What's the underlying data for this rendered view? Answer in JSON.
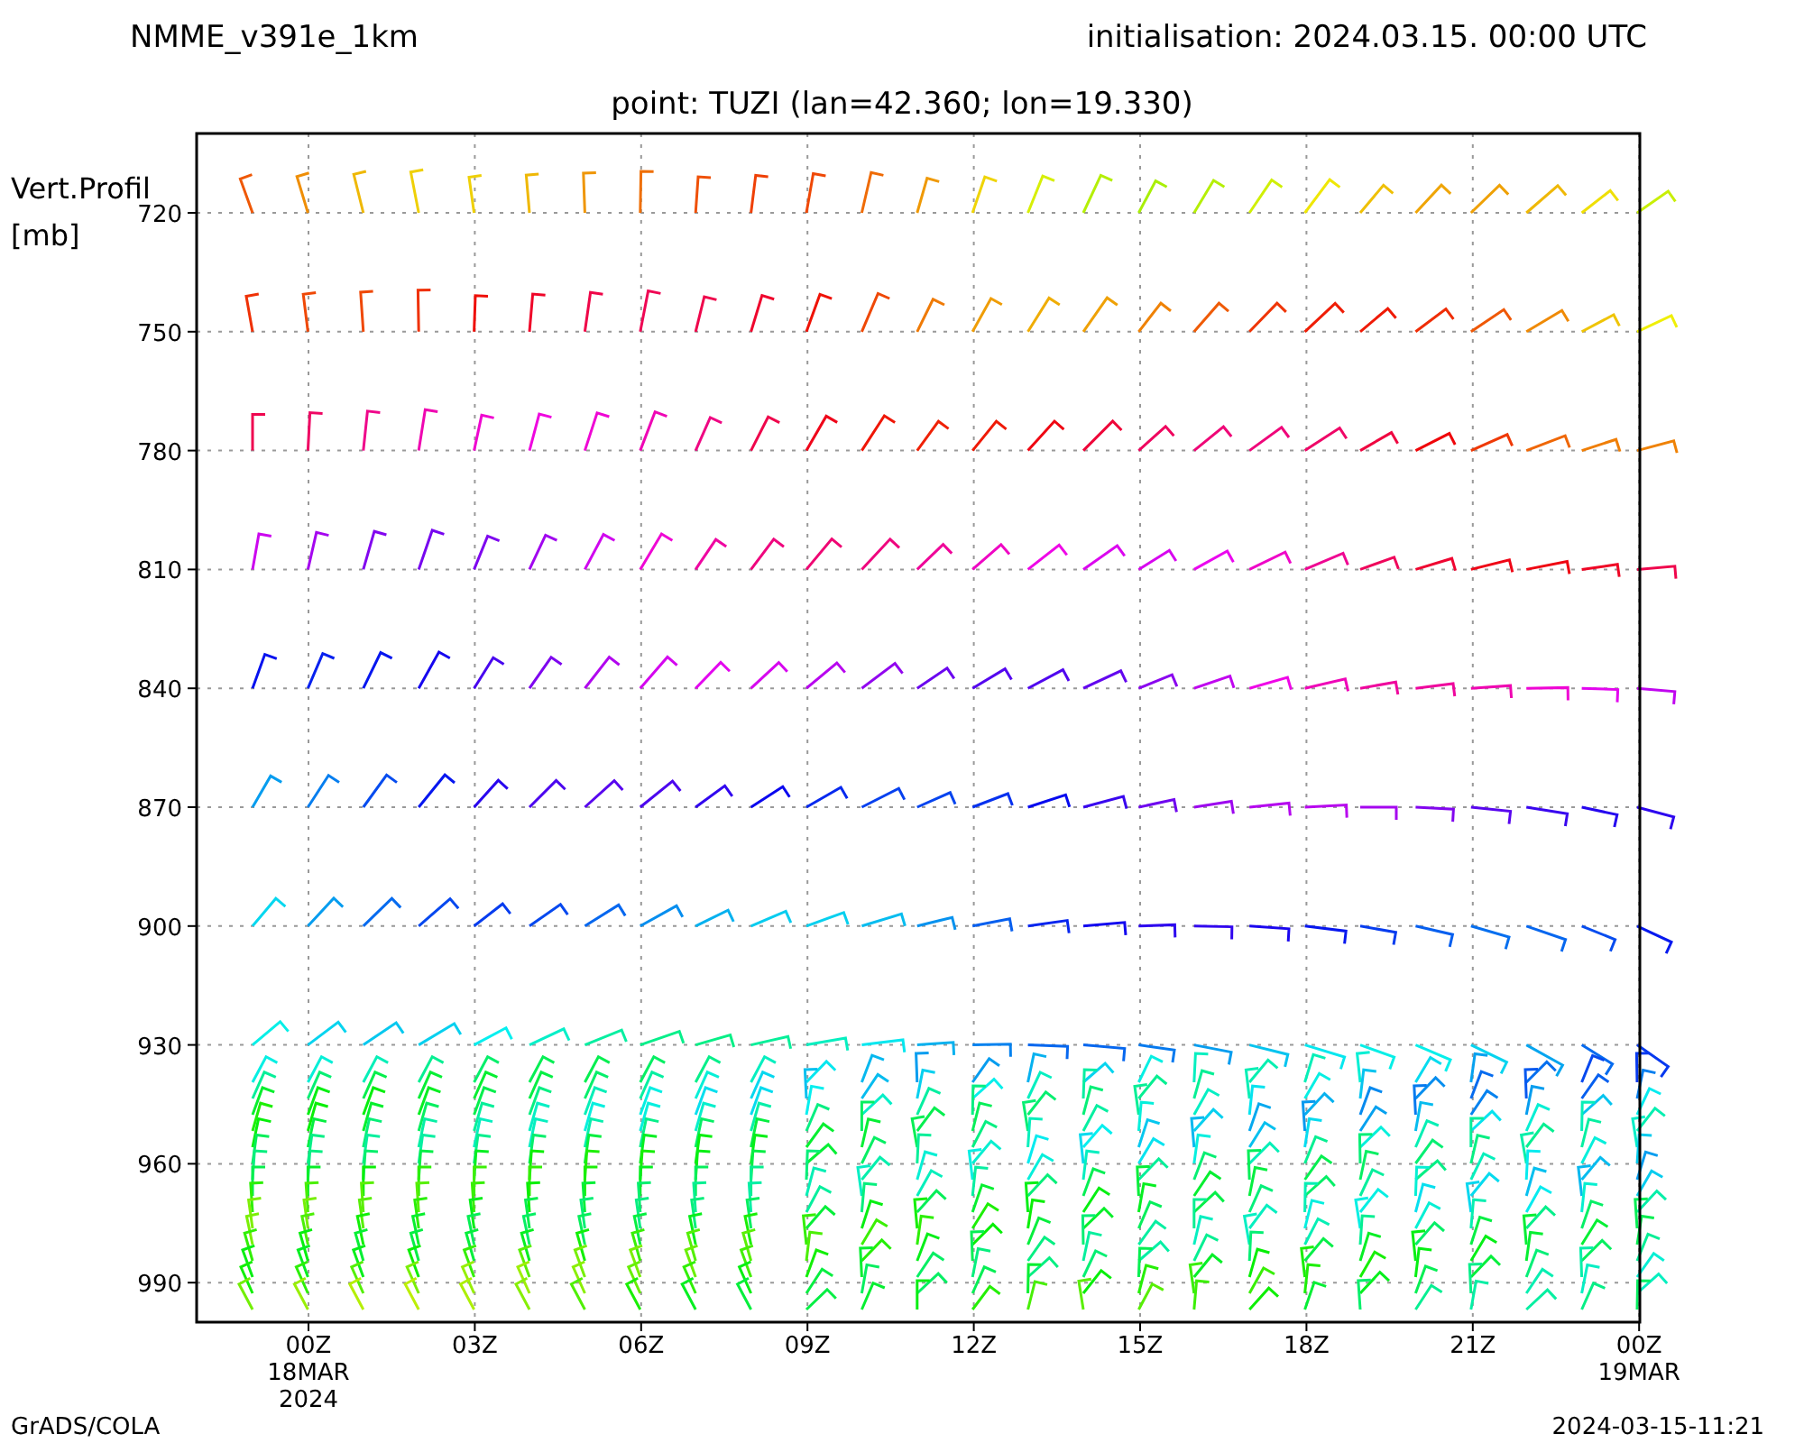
{
  "header": {
    "model": "NMME_v391e_1km",
    "initialisation": "initialisation: 2024.03.15. 00:00 UTC",
    "point": "point: TUZI (lan=42.360; lon=19.330)"
  },
  "y_axis": {
    "title_lines": [
      "Vert.Profil",
      "[mb]"
    ],
    "ticks": [
      "720",
      "750",
      "780",
      "810",
      "840",
      "870",
      "900",
      "930",
      "960",
      "990"
    ]
  },
  "x_axis": {
    "ticks": [
      {
        "lines": [
          "00Z",
          "18MAR",
          "2024"
        ]
      },
      {
        "lines": [
          "03Z"
        ]
      },
      {
        "lines": [
          "06Z"
        ]
      },
      {
        "lines": [
          "09Z"
        ]
      },
      {
        "lines": [
          "12Z"
        ]
      },
      {
        "lines": [
          "15Z"
        ]
      },
      {
        "lines": [
          "18Z"
        ]
      },
      {
        "lines": [
          "21Z"
        ]
      },
      {
        "lines": [
          "00Z",
          "19MAR"
        ]
      }
    ]
  },
  "footer": {
    "left": "GrADS/COLA",
    "right": "2024-03-15-11:21"
  }
}
